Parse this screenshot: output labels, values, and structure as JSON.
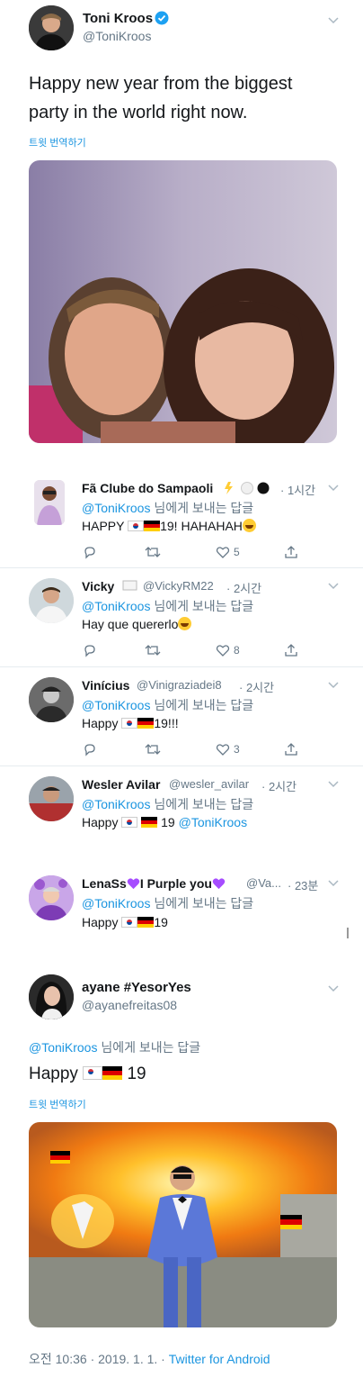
{
  "main_tweet": {
    "display_name": "Toni Kroos",
    "handle": "@ToniKroos",
    "text_line1": "Happy new year from the biggest",
    "text_line2": "party in the world right now.",
    "translate_label": "트윗 번역하기"
  },
  "replies": [
    {
      "name": "Fã Clube do Sampaoli",
      "handle": "",
      "time": "· 1시간",
      "reply_to_user": "@ToniKroos",
      "reply_to_suffix": " 님에게 보내는 답글",
      "text_before": "HAPPY ",
      "text_after": "19! HAHAHAH",
      "likes": "5"
    },
    {
      "name": "Vicky",
      "handle": "@VickyRM22",
      "time": "· 2시간",
      "reply_to_user": "@ToniKroos",
      "reply_to_suffix": " 님에게 보내는 답글",
      "text": "Hay que quererlo",
      "likes": "8"
    },
    {
      "name": "Vinícius",
      "handle": "@Vinigraziadei8",
      "time": "· 2시간",
      "reply_to_user": "@ToniKroos",
      "reply_to_suffix": " 님에게 보내는 답글",
      "text_before": "Happy ",
      "text_after": "19!!!",
      "likes": "3"
    },
    {
      "name": "Wesler Avilar",
      "handle": "@wesler_avilar",
      "time": "· 2시간",
      "reply_to_user": "@ToniKroos",
      "reply_to_suffix": " 님에게 보내는 답글",
      "text_before": "Happy ",
      "text_mid": " 19 ",
      "mention": "@ToniKroos"
    },
    {
      "name_a": "LenaSs",
      "name_b": "I Purple you",
      "handle": "@Va...",
      "time": "· 23분",
      "reply_to_user": "@ToniKroos",
      "reply_to_suffix": " 님에게 보내는 답글",
      "text_before": "Happy ",
      "text_after": "19"
    }
  ],
  "focus_tweet": {
    "display_name": "ayane #YesorYes",
    "handle": "@ayanefreitas08",
    "reply_to_user": "@ToniKroos",
    "reply_to_suffix": " 님에게 보내는 답글",
    "text_before": "Happy ",
    "text_after": " 19",
    "translate_label": "트윗 번역하기",
    "timestamp": "오전 10:36 · 2019. 1. 1. · ",
    "source": "Twitter for Android"
  },
  "colors": {
    "link": "#1b95e0",
    "muted": "#657786",
    "verified": "#1da1f2",
    "purple_heart": "#a64dff"
  }
}
